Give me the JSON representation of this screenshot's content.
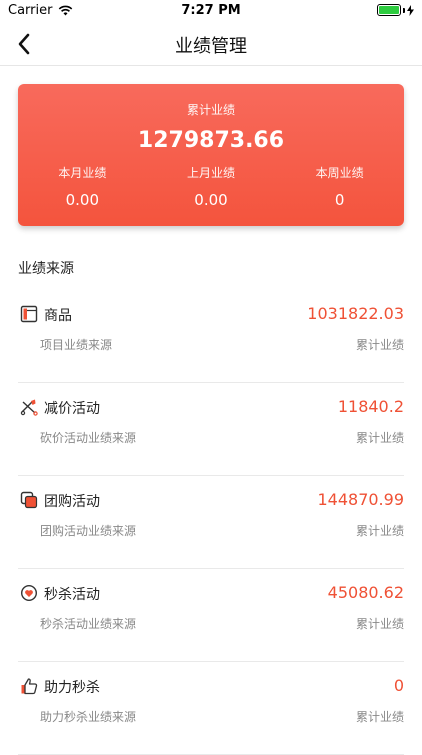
{
  "status_bar": {
    "carrier": "Carrier",
    "time": "7:27 PM"
  },
  "nav": {
    "title": "业绩管理"
  },
  "summary": {
    "total_label": "累计业绩",
    "total_value": "1279873.66",
    "stats": [
      {
        "label": "本月业绩",
        "value": "0.00"
      },
      {
        "label": "上月业绩",
        "value": "0.00"
      },
      {
        "label": "本周业绩",
        "value": "0"
      }
    ]
  },
  "section_title": "业绩来源",
  "sources": [
    {
      "name": "商品",
      "value": "1031822.03",
      "desc": "项目业绩来源",
      "value_label": "累计业绩",
      "icon": "product-icon"
    },
    {
      "name": "减价活动",
      "value": "11840.2",
      "desc": "砍价活动业绩来源",
      "value_label": "累计业绩",
      "icon": "bargain-icon"
    },
    {
      "name": "团购活动",
      "value": "144870.99",
      "desc": "团购活动业绩来源",
      "value_label": "累计业绩",
      "icon": "group-buy-icon"
    },
    {
      "name": "秒杀活动",
      "value": "45080.62",
      "desc": "秒杀活动业绩来源",
      "value_label": "累计业绩",
      "icon": "flash-sale-icon"
    },
    {
      "name": "助力秒杀",
      "value": "0",
      "desc": "助力秒杀业绩来源",
      "value_label": "累计业绩",
      "icon": "assist-icon"
    }
  ],
  "colors": {
    "accent": "#ef5135",
    "card_top": "#f86a5c",
    "card_bottom": "#f4543d"
  }
}
